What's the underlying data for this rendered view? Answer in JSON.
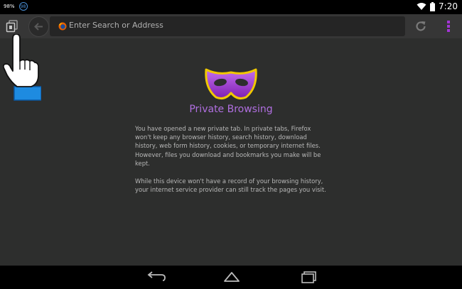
{
  "status_bar": {
    "battery_text": "98%",
    "notification_badge": "98",
    "time": "7:20",
    "icons": [
      "wifi-icon",
      "battery-icon"
    ]
  },
  "toolbar": {
    "url_placeholder": "Enter Search or Address",
    "icons": [
      "tabs-icon",
      "back-arrow-icon",
      "firefox-icon",
      "reload-icon",
      "menu-overflow-icon"
    ]
  },
  "private_page": {
    "title": "Private Browsing",
    "paragraph_1": "You have opened a new private tab. In private tabs, Firefox won't keep any browser history, search history, download history, web form history, cookies, or temporary internet files. However, files you download and bookmarks you make will be kept.",
    "paragraph_2": "While this device won't have a record of your browsing history, your internet service provider can still track the pages you visit.",
    "icon": "private-mask-icon"
  },
  "navbar": {
    "icons": [
      "back-nav-icon",
      "home-nav-icon",
      "recents-nav-icon"
    ]
  },
  "colors": {
    "accent_purple": "#b06fe0",
    "toolbar_bg": "#363636",
    "content_bg": "#2d2e2d",
    "hand_cuff_blue": "#1e8be0"
  }
}
